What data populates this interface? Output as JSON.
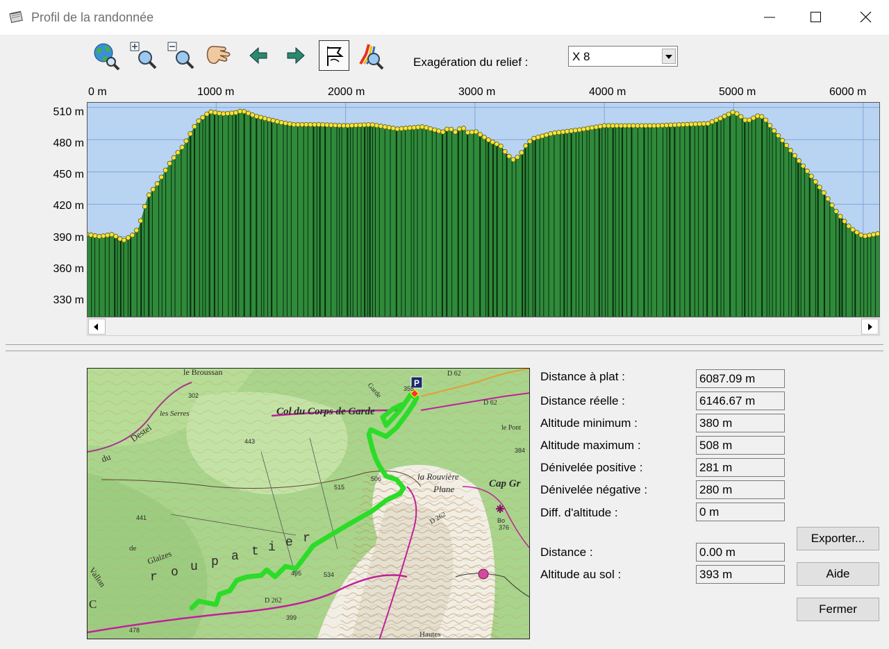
{
  "window": {
    "title": "Profil de la randonnée"
  },
  "toolbar": {
    "buttons": [
      {
        "name": "globe-search-icon"
      },
      {
        "name": "zoom-in-icon"
      },
      {
        "name": "zoom-out-icon"
      },
      {
        "name": "hand-pan-icon"
      },
      {
        "name": "arrow-left-icon"
      },
      {
        "name": "arrow-right-icon"
      },
      {
        "name": "flag-icon",
        "active": true
      },
      {
        "name": "path-zoom-icon"
      }
    ],
    "relief_label": "Exagération du relief :",
    "relief_value": "X 8"
  },
  "chart_data": {
    "type": "area",
    "x_unit": "m",
    "x_ticks": [
      "0 m",
      "1000 m",
      "2000 m",
      "3000 m",
      "4000 m",
      "5000 m",
      "6000 m"
    ],
    "y_ticks": [
      "510 m",
      "480 m",
      "450 m",
      "420 m",
      "390 m",
      "360 m",
      "330 m"
    ],
    "xlim": [
      0,
      6130
    ],
    "ylim": [
      315,
      515
    ],
    "grid": true,
    "profile": [
      [
        0,
        392
      ],
      [
        100,
        390
      ],
      [
        200,
        392
      ],
      [
        280,
        386
      ],
      [
        350,
        391
      ],
      [
        400,
        398
      ],
      [
        470,
        427
      ],
      [
        550,
        440
      ],
      [
        650,
        460
      ],
      [
        750,
        475
      ],
      [
        850,
        496
      ],
      [
        950,
        506
      ],
      [
        1050,
        504
      ],
      [
        1150,
        505
      ],
      [
        1200,
        507
      ],
      [
        1300,
        502
      ],
      [
        1400,
        499
      ],
      [
        1500,
        496
      ],
      [
        1600,
        494
      ],
      [
        1800,
        494
      ],
      [
        2000,
        493
      ],
      [
        2200,
        494
      ],
      [
        2400,
        490
      ],
      [
        2600,
        492
      ],
      [
        2750,
        487
      ],
      [
        2800,
        491
      ],
      [
        2850,
        487
      ],
      [
        2900,
        492
      ],
      [
        2950,
        486
      ],
      [
        3000,
        488
      ],
      [
        3100,
        480
      ],
      [
        3200,
        474
      ],
      [
        3250,
        466
      ],
      [
        3300,
        461
      ],
      [
        3350,
        466
      ],
      [
        3400,
        476
      ],
      [
        3450,
        481
      ],
      [
        3600,
        486
      ],
      [
        3800,
        489
      ],
      [
        4000,
        493
      ],
      [
        4200,
        493
      ],
      [
        4400,
        493
      ],
      [
        4600,
        494
      ],
      [
        4800,
        495
      ],
      [
        4900,
        500
      ],
      [
        5000,
        506
      ],
      [
        5050,
        502
      ],
      [
        5100,
        497
      ],
      [
        5200,
        503
      ],
      [
        5250,
        498
      ],
      [
        5300,
        490
      ],
      [
        5400,
        476
      ],
      [
        5500,
        461
      ],
      [
        5600,
        446
      ],
      [
        5700,
        430
      ],
      [
        5800,
        412
      ],
      [
        5900,
        398
      ],
      [
        6000,
        390
      ],
      [
        6130,
        393
      ]
    ]
  },
  "stats": [
    {
      "label": "Distance à plat :",
      "value": "6087.09 m"
    },
    {
      "label": "Distance réelle :",
      "value": "6146.67 m"
    },
    {
      "label": "Altitude minimum :",
      "value": "380 m"
    },
    {
      "label": "Altitude maximum :",
      "value": "508 m"
    },
    {
      "label": "Dénivelée positive :",
      "value": "281 m"
    },
    {
      "label": "Dénivelée négative :",
      "value": "280 m"
    },
    {
      "label": "Diff. d'altitude :",
      "value": "0 m"
    }
  ],
  "cursor": [
    {
      "label": "Distance :",
      "value": "0.00 m"
    },
    {
      "label": "Altitude au sol :",
      "value": "393 m"
    }
  ],
  "buttons": {
    "export": "Exporter...",
    "help": "Aide",
    "close": "Fermer"
  },
  "map": {
    "labels": [
      "le Broussan",
      "Col du Corps de Garde",
      "la Rouvière",
      "Plane",
      "Cap Gr",
      "Destel",
      "du",
      "les Serres",
      "Vallon",
      "de",
      "Glaizes",
      "r",
      "o",
      "u",
      "p",
      "a",
      "t",
      "i",
      "e",
      "r",
      "C",
      "D 62",
      "D 62",
      "D 262",
      "D 262",
      "le Pont",
      "Garde",
      "Hautes",
      "443",
      "515",
      "506",
      "441",
      "384",
      "495",
      "534",
      "355",
      "399",
      "478",
      "302",
      "Bo",
      "376",
      "P"
    ]
  }
}
